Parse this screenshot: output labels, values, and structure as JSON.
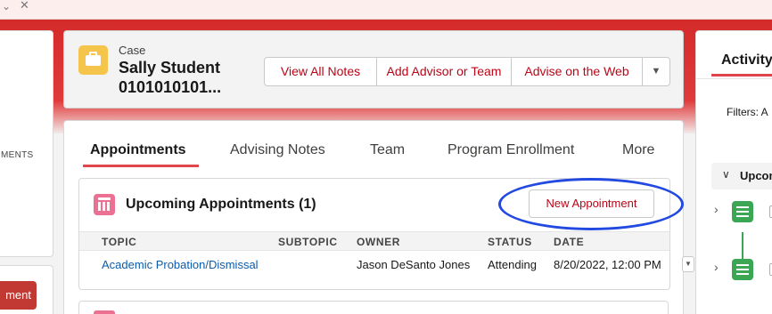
{
  "topbar": {
    "chevron": "⌄",
    "close": "✕"
  },
  "left_panel": {
    "label_fragment": "MENTS",
    "button_fragment": "ment"
  },
  "case": {
    "label": "Case",
    "name": "Sally Student",
    "number": "0101010101...",
    "icon": "briefcase-icon",
    "icon_color": "#f4c54a",
    "actions": [
      "View All Notes",
      "Add Advisor or Team",
      "Advise on the Web"
    ],
    "more_actions": "▼"
  },
  "tabs": [
    {
      "label": "Appointments",
      "active": true
    },
    {
      "label": "Advising Notes"
    },
    {
      "label": "Team"
    },
    {
      "label": "Program Enrollment"
    },
    {
      "label": "More"
    }
  ],
  "appointments": {
    "title": "Upcoming Appointments (1)",
    "icon": "calendar-icon",
    "new_button": "New Appointment",
    "columns": [
      "TOPIC",
      "SUBTOPIC",
      "OWNER",
      "STATUS",
      "DATE"
    ],
    "rows": [
      {
        "topic": "Academic Probation/Dismissal",
        "subtopic": "",
        "owner": "Jason DeSanto Jones",
        "status": "Attending",
        "date": "8/20/2022, 12:00 PM"
      }
    ],
    "row_menu": "▼"
  },
  "activity": {
    "title": "Activity",
    "filters": "Filters: A",
    "section": "Upcom",
    "section_chevron": "∨",
    "item_chevron": "›"
  },
  "colors": {
    "brand_red": "#d42a2a",
    "link_blue": "#0b5cab",
    "action_red": "#ba0517",
    "annotation_blue": "#2249e0",
    "task_green": "#3ba755"
  }
}
